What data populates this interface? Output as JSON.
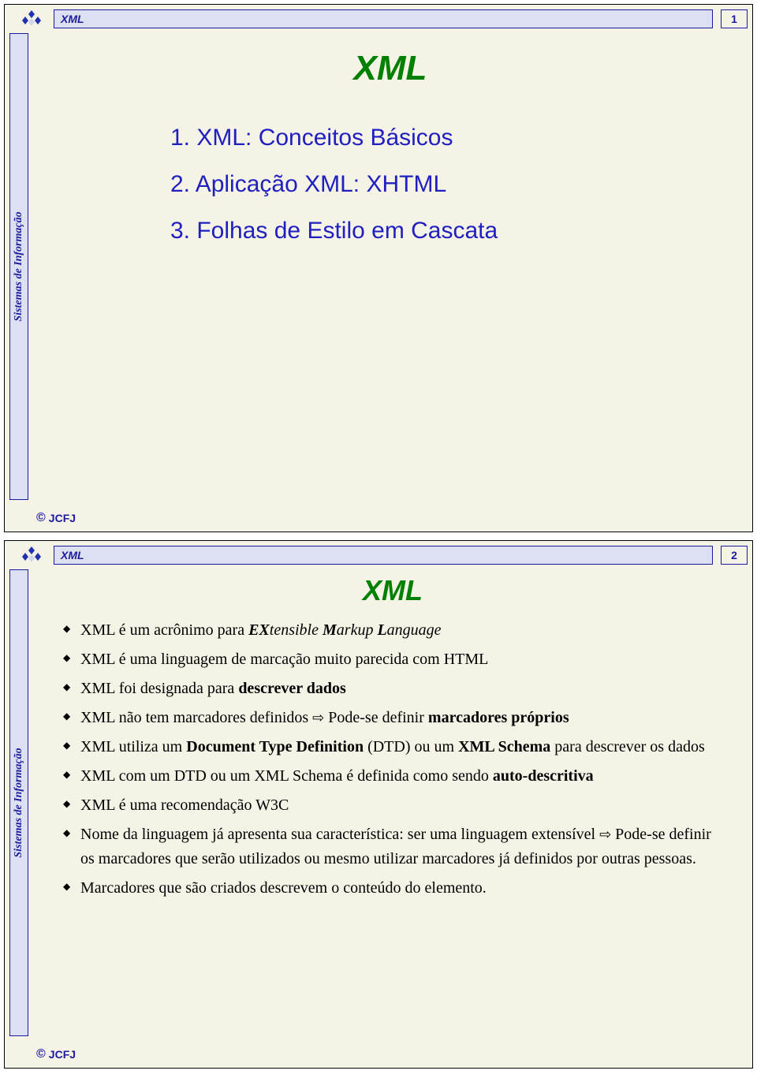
{
  "common": {
    "header_title": "XML",
    "sidebar": "Sistemas de Informação",
    "footer_author": "JCFJ",
    "copyright": "©"
  },
  "slide1": {
    "page": "1",
    "title": "XML",
    "toc": {
      "i1": "1. XML: Conceitos Básicos",
      "i2": "2. Aplicação XML: XHTML",
      "i3": "3. Folhas de Estilo em Cascata"
    }
  },
  "slide2": {
    "page": "2",
    "title": "XML",
    "b1_pre": "XML é um acrônimo para ",
    "b1_em1": "E",
    "b1_em2": "X",
    "b1_mid1": "tensible ",
    "b1_em3": "M",
    "b1_mid2": "arkup ",
    "b1_em4": "L",
    "b1_post": "anguage",
    "b2": "XML é uma linguagem de marcação muito parecida com HTML",
    "b3_pre": "XML foi designada para ",
    "b3_bold": "descrever dados",
    "b4_pre": "XML não tem marcadores definidos ",
    "b4_arrow": "⇨",
    "b4_mid": " Pode-se definir ",
    "b4_bold": "marcadores próprios",
    "b5_pre": "XML utiliza um ",
    "b5_bold1": "Document Type Definition",
    "b5_mid1": " (DTD) ou um ",
    "b5_bold2": "XML Schema",
    "b5_post": " para descrever os dados",
    "b6_pre": "XML com um DTD ou um XML Schema é definida como sendo ",
    "b6_bold": "auto-descritiva",
    "b7": "XML é uma recomendação W3C",
    "b8_pre": "Nome da linguagem já apresenta sua característica: ser uma linguagem extensível ",
    "b8_arrow": "⇨",
    "b8_post": " Pode-se definir os marcadores que serão utilizados ou mesmo utilizar marcadores já definidos por outras pessoas.",
    "b9": "Marcadores que são criados descrevem o conteúdo do elemento."
  }
}
